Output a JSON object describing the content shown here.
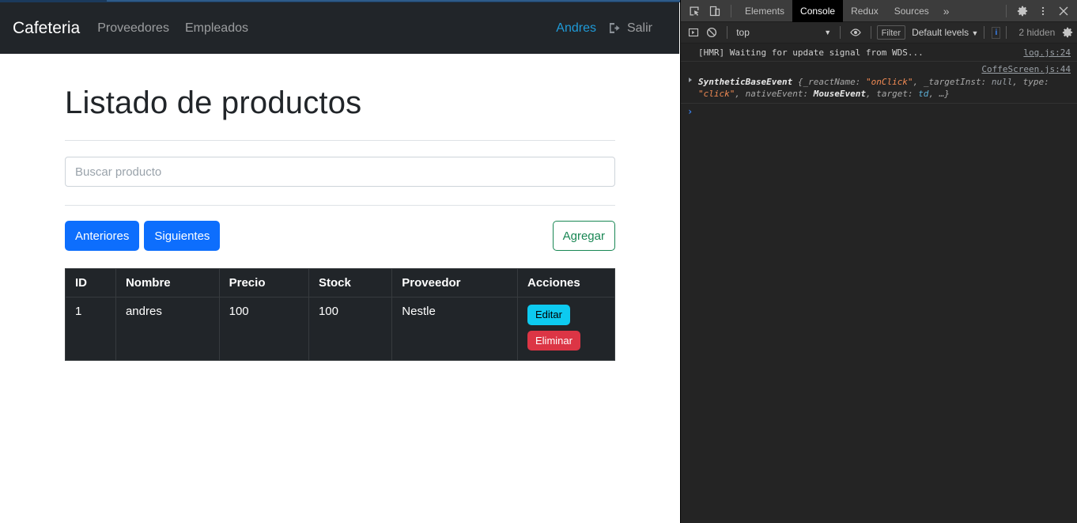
{
  "navbar": {
    "brand": "Cafeteria",
    "links": [
      {
        "label": "Proveedores"
      },
      {
        "label": "Empleados"
      }
    ],
    "user": "Andres",
    "logout_label": "Salir",
    "logout_icon": "sign-out-icon",
    "bg_color": "#212529",
    "user_color": "#1f9bd8"
  },
  "main": {
    "title": "Listado de productos",
    "search": {
      "value": "",
      "placeholder": "Buscar producto"
    },
    "buttons": {
      "prev": "Anteriores",
      "next": "Siguientes",
      "add": "Agregar",
      "primary_color": "#0d6efd",
      "add_color": "#198754"
    },
    "table": {
      "columns": [
        "ID",
        "Nombre",
        "Precio",
        "Stock",
        "Proveedor",
        "Acciones"
      ],
      "rows": [
        {
          "id": "1",
          "nombre": "andres",
          "precio": "100",
          "stock": "100",
          "proveedor": "Nestle",
          "edit_label": "Editar",
          "delete_label": "Eliminar"
        }
      ],
      "edit_color": "#0dcaf0",
      "delete_color": "#dc3545",
      "bg_color": "#212529"
    }
  },
  "devtools": {
    "tabs": [
      {
        "label": "Elements",
        "active": false
      },
      {
        "label": "Console",
        "active": true
      },
      {
        "label": "Redux",
        "active": false
      },
      {
        "label": "Sources",
        "active": false
      }
    ],
    "more_label": "»",
    "icons": {
      "inspect": "inspect-element-icon",
      "device": "device-toolbar-icon",
      "settings": "gear-icon",
      "kebab": "more-options-icon",
      "close": "close-icon",
      "execution_context": "execution-context-icon",
      "clear": "clear-console-icon",
      "eye": "live-expression-icon",
      "filter_settings": "console-settings-icon"
    },
    "filterbar": {
      "context": "top",
      "filter_placeholder": "Filter",
      "levels": "Default levels",
      "levels_caret": "▼",
      "hidden": "2 hidden",
      "info_badge": "i"
    },
    "console": {
      "entries": [
        {
          "kind": "text",
          "text": "[HMR] Waiting for update signal from WDS...",
          "source": "log.js:24"
        },
        {
          "kind": "object",
          "source": "CoffeScreen.js:44",
          "class_name": "SyntheticBaseEvent",
          "open_brace": "{",
          "props": [
            {
              "key": "_reactName:",
              "value": "\"onClick\"",
              "type": "string"
            },
            {
              "key": "_targetInst:",
              "value": "null",
              "type": "null"
            },
            {
              "key": "type:",
              "value": "\"click\"",
              "type": "string"
            },
            {
              "key": "nativeEvent:",
              "value": "MouseEvent",
              "type": "ctor"
            },
            {
              "key": "target:",
              "value": "td",
              "type": "node"
            }
          ],
          "ellipsis": "…}"
        }
      ],
      "prompt_caret": "›"
    }
  }
}
